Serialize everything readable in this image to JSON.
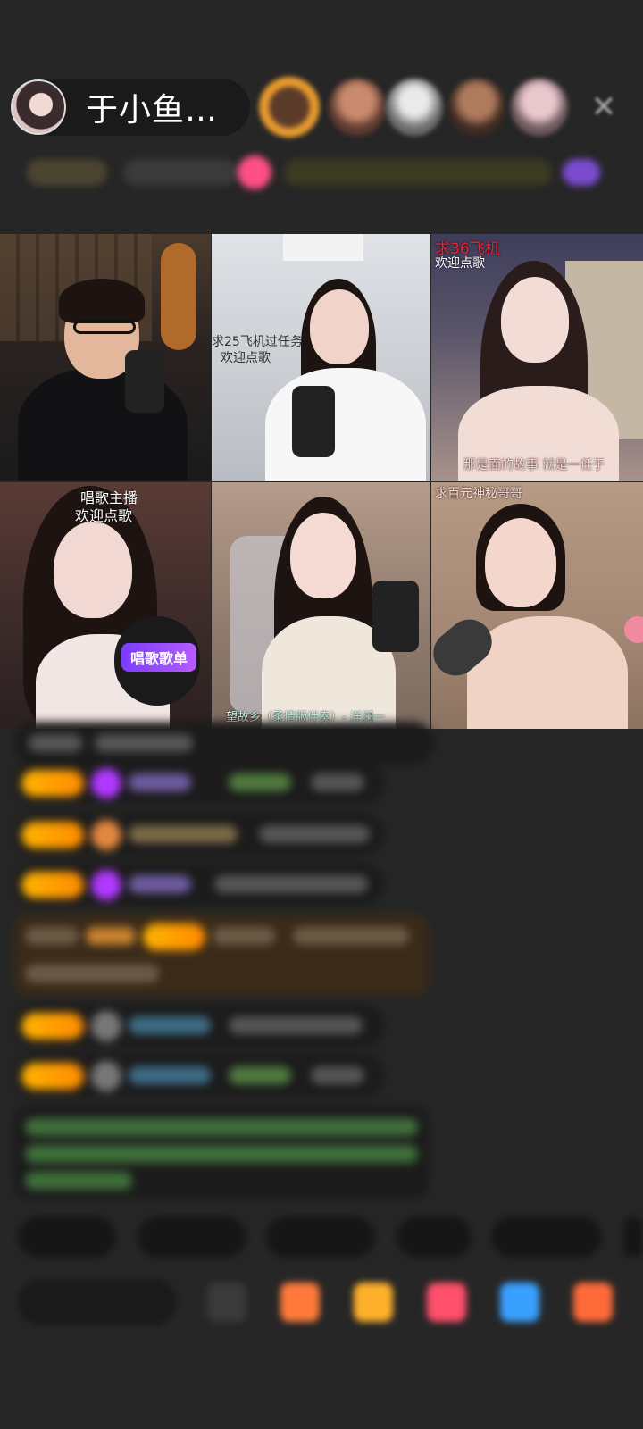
{
  "header": {
    "host_name": "于小鱼爱…",
    "close_icon": "close-icon"
  },
  "tiles": [
    {
      "caption_top": "",
      "caption_bottom": ""
    },
    {
      "caption_top": "求25飞机过任务",
      "caption_top2": "欢迎点歌"
    },
    {
      "caption_top": "求36飞机",
      "caption_top2": "欢迎点歌",
      "caption_bottom": "那是面的故事 就是一任于"
    },
    {
      "caption_top": "唱歌主播",
      "caption_top2": "欢迎点歌",
      "badge": "唱歌歌单"
    },
    {
      "caption_bottom": "望故乡（柔情版伴奏）- 洋澜一"
    },
    {
      "caption_top": "求百元神秘哥哥"
    }
  ],
  "colors": {
    "background": "#262626",
    "badge_gold": "#ffb400",
    "gem_purple": "#b038ff"
  }
}
